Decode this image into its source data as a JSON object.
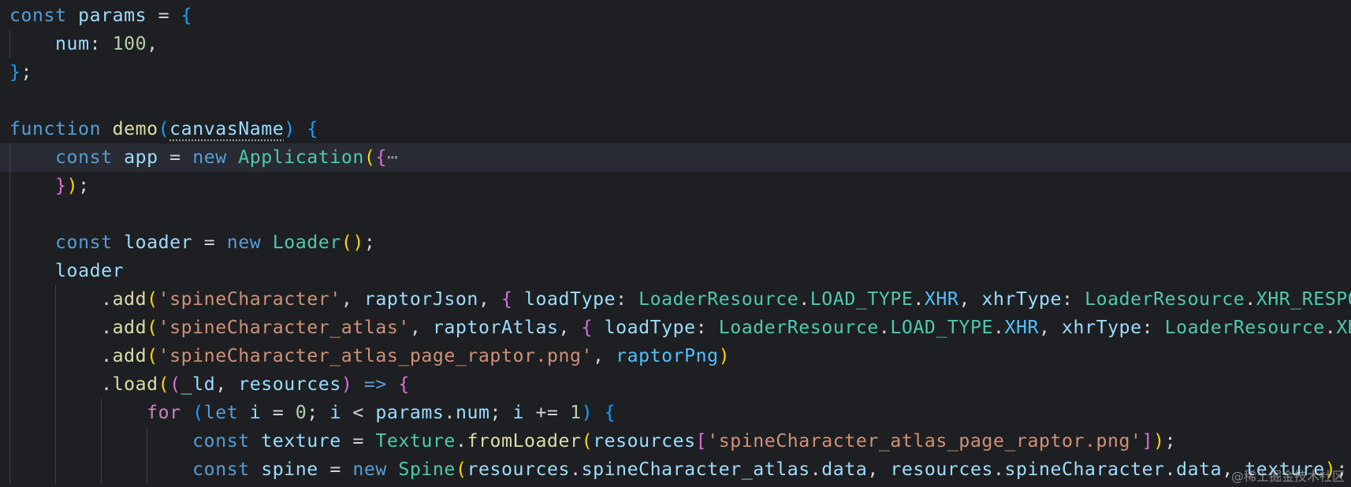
{
  "editor": {
    "theme": "dark",
    "colors": {
      "background": "#1e1f22",
      "current_line": "#282b33",
      "keyword": "#569cd6",
      "control": "#c586c0",
      "variable": "#9cdcfe",
      "constant": "#4fc1ff",
      "function": "#dcdcaa",
      "class": "#4ec9b0",
      "string": "#ce9178",
      "number": "#b5cea8",
      "bracket_1": "#ffd700",
      "bracket_2": "#da70d6",
      "bracket_3": "#179fff"
    },
    "lines": [
      [
        {
          "t": "const",
          "c": "kw"
        },
        {
          "t": " "
        },
        {
          "t": "params",
          "c": "var"
        },
        {
          "t": " = "
        },
        {
          "t": "{",
          "c": "b3"
        }
      ],
      [
        {
          "t": "    "
        },
        {
          "t": "num",
          "c": "var"
        },
        {
          "t": ": "
        },
        {
          "t": "100",
          "c": "num"
        },
        {
          "t": ","
        }
      ],
      [
        {
          "t": "}",
          "c": "b3"
        },
        {
          "t": ";"
        }
      ],
      [],
      [
        {
          "t": "function",
          "c": "kw"
        },
        {
          "t": " "
        },
        {
          "t": "demo",
          "c": "fn"
        },
        {
          "t": "(",
          "c": "b3"
        },
        {
          "t": "canvasName",
          "c": "var dotted"
        },
        {
          "t": ")",
          "c": "b3"
        },
        {
          "t": " "
        },
        {
          "t": "{",
          "c": "b3"
        }
      ],
      [
        {
          "t": "    "
        },
        {
          "t": "const",
          "c": "kw"
        },
        {
          "t": " "
        },
        {
          "t": "app",
          "c": "var"
        },
        {
          "t": " = "
        },
        {
          "t": "new",
          "c": "kw"
        },
        {
          "t": " "
        },
        {
          "t": "Application",
          "c": "cls"
        },
        {
          "t": "(",
          "c": "b1"
        },
        {
          "t": "{",
          "c": "b2"
        },
        {
          "t": "⋯",
          "c": "fold"
        }
      ],
      [
        {
          "t": "    "
        },
        {
          "t": "}",
          "c": "b2"
        },
        {
          "t": ")",
          "c": "b1"
        },
        {
          "t": ";"
        }
      ],
      [],
      [
        {
          "t": "    "
        },
        {
          "t": "const",
          "c": "kw"
        },
        {
          "t": " "
        },
        {
          "t": "loader",
          "c": "var"
        },
        {
          "t": " = "
        },
        {
          "t": "new",
          "c": "kw"
        },
        {
          "t": " "
        },
        {
          "t": "Loader",
          "c": "cls"
        },
        {
          "t": "()",
          "c": "b1"
        },
        {
          "t": ";"
        }
      ],
      [
        {
          "t": "    "
        },
        {
          "t": "loader",
          "c": "var"
        }
      ],
      [
        {
          "t": "        ."
        },
        {
          "t": "add",
          "c": "fn"
        },
        {
          "t": "(",
          "c": "b1"
        },
        {
          "t": "'spineCharacter'",
          "c": "str"
        },
        {
          "t": ", "
        },
        {
          "t": "raptorJson",
          "c": "var"
        },
        {
          "t": ", "
        },
        {
          "t": "{",
          "c": "b2"
        },
        {
          "t": " "
        },
        {
          "t": "loadType",
          "c": "var"
        },
        {
          "t": ": "
        },
        {
          "t": "LoaderResource",
          "c": "cls"
        },
        {
          "t": "."
        },
        {
          "t": "LOAD_TYPE",
          "c": "cls"
        },
        {
          "t": "."
        },
        {
          "t": "XHR",
          "c": "cst"
        },
        {
          "t": ", "
        },
        {
          "t": "xhrType",
          "c": "var"
        },
        {
          "t": ": "
        },
        {
          "t": "LoaderResource",
          "c": "cls"
        },
        {
          "t": "."
        },
        {
          "t": "XHR_RESPONSE_TYPE",
          "c": "cls"
        }
      ],
      [
        {
          "t": "        ."
        },
        {
          "t": "add",
          "c": "fn"
        },
        {
          "t": "(",
          "c": "b1"
        },
        {
          "t": "'spineCharacter_atlas'",
          "c": "str"
        },
        {
          "t": ", "
        },
        {
          "t": "raptorAtlas",
          "c": "var"
        },
        {
          "t": ", "
        },
        {
          "t": "{",
          "c": "b2"
        },
        {
          "t": " "
        },
        {
          "t": "loadType",
          "c": "var"
        },
        {
          "t": ": "
        },
        {
          "t": "LoaderResource",
          "c": "cls"
        },
        {
          "t": "."
        },
        {
          "t": "LOAD_TYPE",
          "c": "cls"
        },
        {
          "t": "."
        },
        {
          "t": "XHR",
          "c": "cst"
        },
        {
          "t": ", "
        },
        {
          "t": "xhrType",
          "c": "var"
        },
        {
          "t": ": "
        },
        {
          "t": "LoaderResource",
          "c": "cls"
        },
        {
          "t": "."
        },
        {
          "t": "XHR_RESPONSE_TYPE",
          "c": "cls"
        }
      ],
      [
        {
          "t": "        ."
        },
        {
          "t": "add",
          "c": "fn"
        },
        {
          "t": "(",
          "c": "b1"
        },
        {
          "t": "'spineCharacter_atlas_page_raptor.png'",
          "c": "str"
        },
        {
          "t": ", "
        },
        {
          "t": "raptorPng",
          "c": "cst"
        },
        {
          "t": ")",
          "c": "b1"
        }
      ],
      [
        {
          "t": "        ."
        },
        {
          "t": "load",
          "c": "fn"
        },
        {
          "t": "(",
          "c": "b1"
        },
        {
          "t": "(",
          "c": "b2"
        },
        {
          "t": "_ld",
          "c": "var"
        },
        {
          "t": ", "
        },
        {
          "t": "resources",
          "c": "var"
        },
        {
          "t": ")",
          "c": "b2"
        },
        {
          "t": " "
        },
        {
          "t": "=>",
          "c": "kw"
        },
        {
          "t": " "
        },
        {
          "t": "{",
          "c": "b2"
        }
      ],
      [
        {
          "t": "            "
        },
        {
          "t": "for",
          "c": "ctl"
        },
        {
          "t": " "
        },
        {
          "t": "(",
          "c": "b3"
        },
        {
          "t": "let",
          "c": "kw"
        },
        {
          "t": " "
        },
        {
          "t": "i",
          "c": "var"
        },
        {
          "t": " = "
        },
        {
          "t": "0",
          "c": "num"
        },
        {
          "t": "; "
        },
        {
          "t": "i",
          "c": "var"
        },
        {
          "t": " < "
        },
        {
          "t": "params",
          "c": "var"
        },
        {
          "t": "."
        },
        {
          "t": "num",
          "c": "var"
        },
        {
          "t": "; "
        },
        {
          "t": "i",
          "c": "var"
        },
        {
          "t": " += "
        },
        {
          "t": "1",
          "c": "num"
        },
        {
          "t": ")",
          "c": "b3"
        },
        {
          "t": " "
        },
        {
          "t": "{",
          "c": "b3"
        }
      ],
      [
        {
          "t": "                "
        },
        {
          "t": "const",
          "c": "kw"
        },
        {
          "t": " "
        },
        {
          "t": "texture",
          "c": "var"
        },
        {
          "t": " = "
        },
        {
          "t": "Texture",
          "c": "cls"
        },
        {
          "t": "."
        },
        {
          "t": "fromLoader",
          "c": "fn"
        },
        {
          "t": "(",
          "c": "b1"
        },
        {
          "t": "resources",
          "c": "var"
        },
        {
          "t": "[",
          "c": "b2"
        },
        {
          "t": "'spineCharacter_atlas_page_raptor.png'",
          "c": "str"
        },
        {
          "t": "]",
          "c": "b2"
        },
        {
          "t": ")",
          "c": "b1"
        },
        {
          "t": ";"
        }
      ],
      [
        {
          "t": "                "
        },
        {
          "t": "const",
          "c": "kw"
        },
        {
          "t": " "
        },
        {
          "t": "spine",
          "c": "var"
        },
        {
          "t": " = "
        },
        {
          "t": "new",
          "c": "kw"
        },
        {
          "t": " "
        },
        {
          "t": "Spine",
          "c": "cls"
        },
        {
          "t": "(",
          "c": "b1"
        },
        {
          "t": "resources",
          "c": "var"
        },
        {
          "t": "."
        },
        {
          "t": "spineCharacter_atlas",
          "c": "var"
        },
        {
          "t": "."
        },
        {
          "t": "data",
          "c": "var"
        },
        {
          "t": ", "
        },
        {
          "t": "resources",
          "c": "var"
        },
        {
          "t": "."
        },
        {
          "t": "spineCharacter",
          "c": "var"
        },
        {
          "t": "."
        },
        {
          "t": "data",
          "c": "var"
        },
        {
          "t": ", "
        },
        {
          "t": "texture",
          "c": "var"
        },
        {
          "t": ")",
          "c": "b1"
        },
        {
          "t": ";"
        }
      ]
    ]
  },
  "watermark": "@稀土掘金技术社区"
}
